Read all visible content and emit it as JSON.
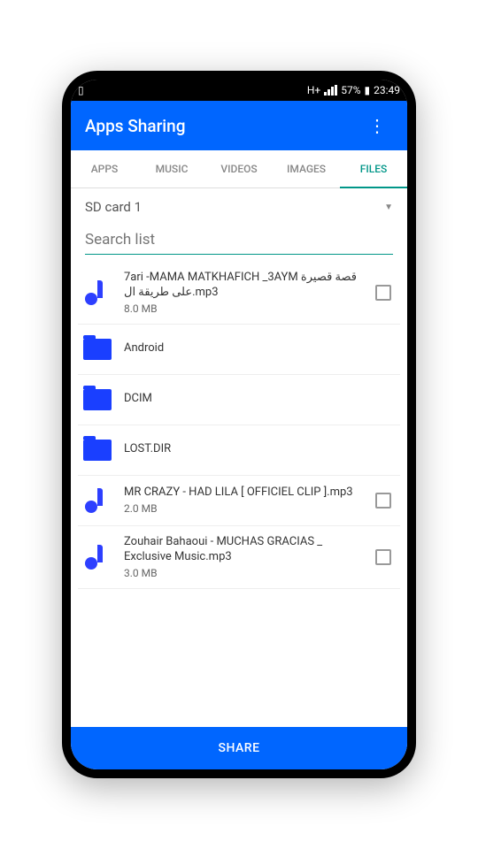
{
  "status_bar": {
    "network_type": "H+",
    "battery": "57%",
    "time": "23:49"
  },
  "app_bar": {
    "title": "Apps Sharing"
  },
  "tabs": [
    {
      "label": "APPS",
      "active": false
    },
    {
      "label": "MUSIC",
      "active": false
    },
    {
      "label": "VIDEOS",
      "active": false
    },
    {
      "label": "IMAGES",
      "active": false
    },
    {
      "label": "FILES",
      "active": true
    }
  ],
  "storage": {
    "selected": "SD card 1"
  },
  "search": {
    "placeholder": "Search list"
  },
  "files": [
    {
      "type": "music",
      "name": "7ari -MAMA MATKHAFICH _3AYM قصة قصيرة على طريقة ال.mp3",
      "size": "8.0 MB",
      "checkable": true
    },
    {
      "type": "folder",
      "name": "Android",
      "size": "",
      "checkable": false
    },
    {
      "type": "folder",
      "name": "DCIM",
      "size": "",
      "checkable": false
    },
    {
      "type": "folder",
      "name": "LOST.DIR",
      "size": "",
      "checkable": false
    },
    {
      "type": "music",
      "name": "MR CRAZY - HAD LILA  [ OFFICIEL CLIP ].mp3",
      "size": "2.0 MB",
      "checkable": true
    },
    {
      "type": "music",
      "name": "Zouhair Bahaoui - MUCHAS GRACIAS _ Exclusive Music.mp3",
      "size": "3.0 MB",
      "checkable": true
    }
  ],
  "share_button": {
    "label": "SHARE"
  }
}
